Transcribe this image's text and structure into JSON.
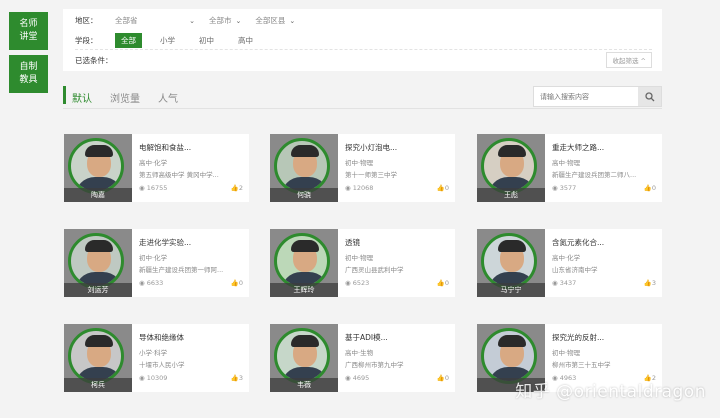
{
  "sidebar": {
    "items": [
      {
        "label": "名师讲堂"
      },
      {
        "label": "自制教具"
      }
    ]
  },
  "filters": {
    "region_label": "地区：",
    "province": "全部省",
    "city": "全部市",
    "district": "全部区县",
    "stage_label": "学段：",
    "stages": [
      "全部",
      "小学",
      "初中",
      "高中"
    ],
    "selected_label": "已选条件：",
    "collapse": "收起筛选"
  },
  "sort": {
    "options": [
      "默认",
      "浏览量",
      "人气"
    ]
  },
  "search": {
    "placeholder": "请输入搜索内容"
  },
  "cards": [
    {
      "name": "陶嘉",
      "title": "电解饱和食盐...",
      "subject": "高中·化学",
      "school": "第五师高级中学 黄冈中学...",
      "views": "16755",
      "likes": "2"
    },
    {
      "name": "何骁",
      "title": "探究小灯泡电...",
      "subject": "初中·物理",
      "school": "第十一师第三中学",
      "views": "12068",
      "likes": "0"
    },
    {
      "name": "王彪",
      "title": "重走大师之路...",
      "subject": "高中·物理",
      "school": "新疆生产建设兵团第二师八...",
      "views": "3577",
      "likes": "0"
    },
    {
      "name": "刘运芳",
      "title": "走进化学实验...",
      "subject": "初中·化学",
      "school": "新疆生产建设兵团第一师阿...",
      "views": "6633",
      "likes": "0"
    },
    {
      "name": "王辉玲",
      "title": "透镜",
      "subject": "初中·物理",
      "school": "广西灵山县武利中学",
      "views": "6523",
      "likes": "0"
    },
    {
      "name": "马宁宁",
      "title": "含氮元素化合...",
      "subject": "高中·化学",
      "school": "山东省济南中学",
      "views": "3437",
      "likes": "3"
    },
    {
      "name": "柯兵",
      "title": "导体和绝缘体",
      "subject": "小学·科学",
      "school": "十堰市人民小学",
      "views": "10309",
      "likes": "3"
    },
    {
      "name": "韦薇",
      "title": "基于ADI模...",
      "subject": "高中·生物",
      "school": "广西柳州市第九中学",
      "views": "4695",
      "likes": "0"
    },
    {
      "name": "",
      "title": "探究光的反射...",
      "subject": "初中·物理",
      "school": "柳州市第三十五中学",
      "views": "4963",
      "likes": "2"
    }
  ],
  "icons": {
    "views": "eye-icon",
    "likes": "thumb-up-icon",
    "search": "search-icon",
    "chevron": "chevron-down-icon"
  },
  "colors": {
    "accent": "#2e8b2e"
  },
  "watermark": "知乎 @orientaldragon"
}
